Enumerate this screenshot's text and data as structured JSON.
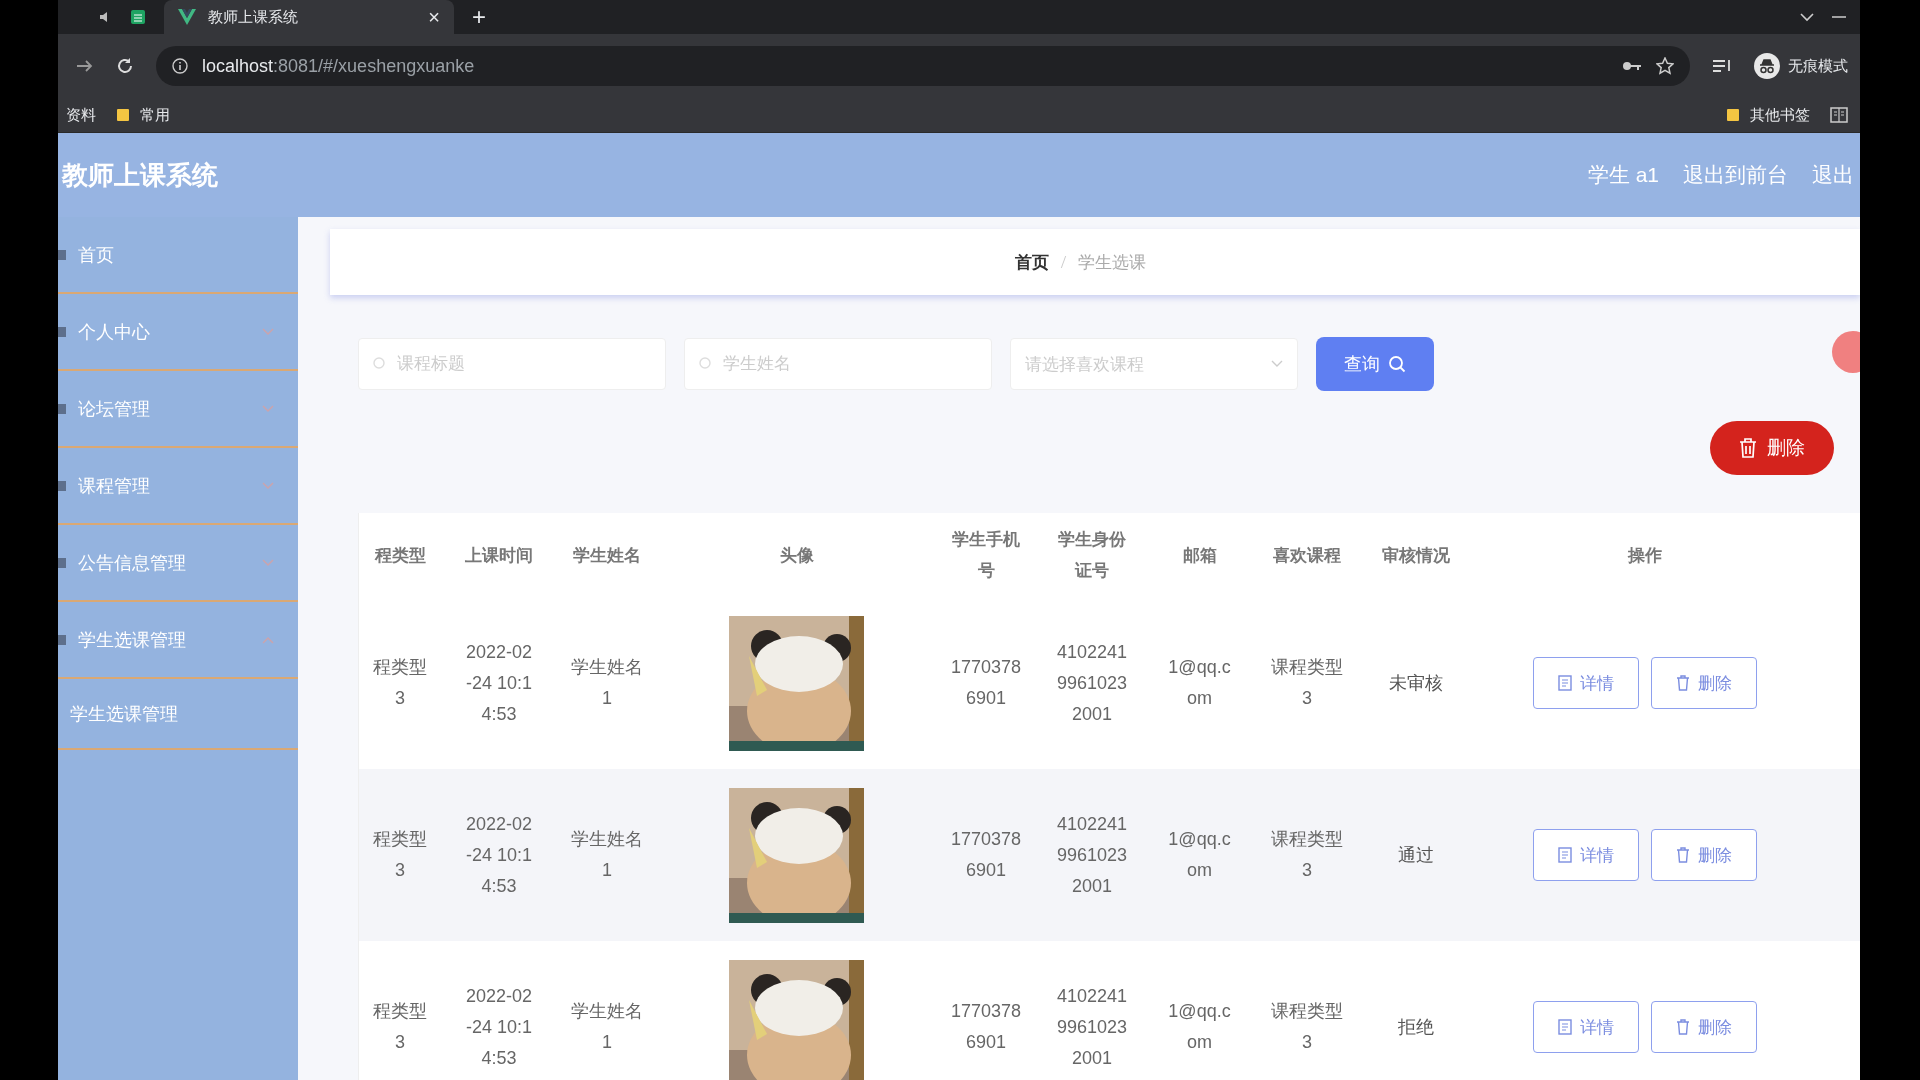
{
  "browser": {
    "tab": {
      "title": "教师上课系统",
      "close": "×"
    },
    "new_tab": "+",
    "address": {
      "host": "localhost",
      "path": ":8081/#/xueshengxuanke"
    },
    "profile": "无痕模式",
    "bookmarks": [
      {
        "label": "资料",
        "kind": "text"
      },
      {
        "label": "常用",
        "kind": "folder"
      }
    ],
    "other_bookmarks": "其他书签"
  },
  "header": {
    "title": "教师上课系统",
    "links": [
      "学生 a1",
      "退出到前台",
      "退出"
    ]
  },
  "sidebar": {
    "items": [
      {
        "label": "首页",
        "kind": "link"
      },
      {
        "label": "个人中心",
        "kind": "submenu",
        "expanded": false
      },
      {
        "label": "论坛管理",
        "kind": "submenu",
        "expanded": false
      },
      {
        "label": "课程管理",
        "kind": "submenu",
        "expanded": false
      },
      {
        "label": "公告信息管理",
        "kind": "submenu",
        "expanded": false
      },
      {
        "label": "学生选课管理",
        "kind": "submenu",
        "expanded": true,
        "children": [
          {
            "label": "学生选课管理"
          }
        ]
      }
    ]
  },
  "breadcrumb": [
    "首页",
    "学生选课"
  ],
  "search": {
    "fields": [
      {
        "placeholder": "课程标题",
        "kind": "input"
      },
      {
        "placeholder": "学生姓名",
        "kind": "input"
      },
      {
        "placeholder": "请选择喜欢课程",
        "kind": "select"
      }
    ],
    "button": "查询"
  },
  "delete_button": "删除",
  "table": {
    "columns": [
      "程类型",
      "上课时间",
      "学生姓名",
      "头像",
      "学生手机号",
      "学生身份证号",
      "邮箱",
      "喜欢课程",
      "审核情况",
      "操作"
    ],
    "rows": [
      {
        "cells": [
          "程类型3",
          "2022-02-24 10:14:53",
          "学生姓名1",
          {
            "kind": "picture"
          },
          "17703786901",
          "410224199610232001",
          "1@qq.com",
          "课程类型3",
          "未审核"
        ],
        "actions": [
          "详情",
          "删除"
        ]
      },
      {
        "cells": [
          "程类型3",
          "2022-02-24 10:14:53",
          "学生姓名1",
          {
            "kind": "picture"
          },
          "17703786901",
          "410224199610232001",
          "1@qq.com",
          "课程类型3",
          "通过"
        ],
        "actions": [
          "详情",
          "删除"
        ]
      },
      {
        "cells": [
          "程类型3",
          "2022-02-24 10:14:53",
          "学生姓名1",
          {
            "kind": "picture"
          },
          "17703786901",
          "410224199610232001",
          "1@qq.com",
          "课程类型3",
          "拒绝"
        ],
        "actions": [
          "详情",
          "删除"
        ]
      }
    ]
  }
}
